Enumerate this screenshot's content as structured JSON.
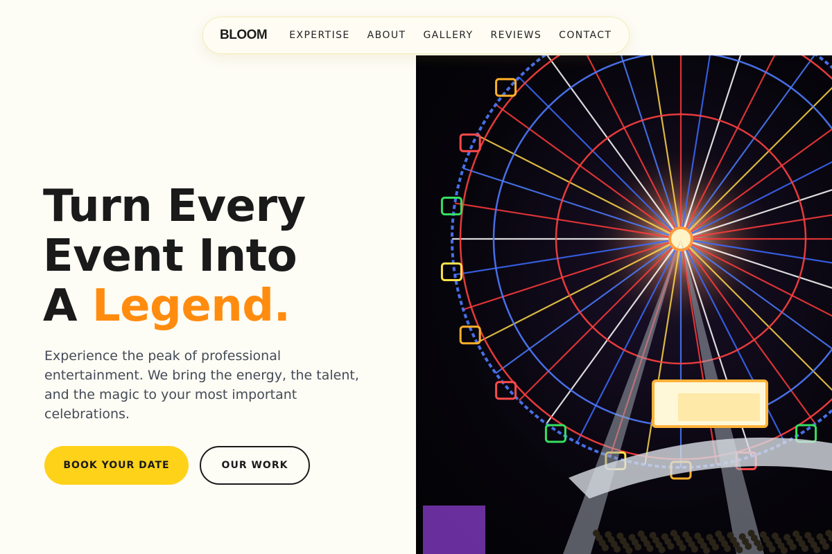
{
  "nav": {
    "brand": "BLOOM",
    "links": [
      "EXPERTISE",
      "ABOUT",
      "GALLERY",
      "REVIEWS",
      "CONTACT"
    ]
  },
  "hero": {
    "headline_line1": "Turn Every",
    "headline_line2": "Event Into",
    "headline_line3_prefix": "A ",
    "headline_accent": "Legend.",
    "lead": "Experience the peak of professional entertainment. We bring the energy, the talent, and the magic to your most important celebrations.",
    "primary_button": "BOOK YOUR DATE",
    "secondary_button": "OUR WORK",
    "image_alt": "Illuminated ferris wheel at night"
  },
  "colors": {
    "background": "#fdfcf5",
    "accent_orange": "#ff8c0f",
    "button_yellow": "#ffd21a",
    "text_dark": "#1a1a1a"
  }
}
